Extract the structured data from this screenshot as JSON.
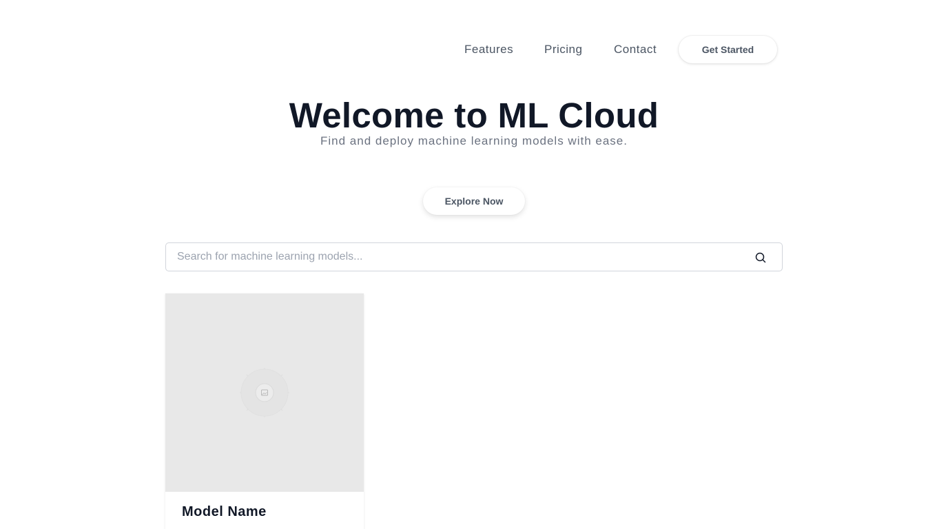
{
  "nav": {
    "links": [
      {
        "label": "Features"
      },
      {
        "label": "Pricing"
      },
      {
        "label": "Contact"
      }
    ],
    "cta_label": "Get Started"
  },
  "hero": {
    "title": "Welcome to ML Cloud",
    "subtitle": "Find and deploy machine learning models with ease.",
    "explore_label": "Explore Now"
  },
  "search": {
    "placeholder": "Search for machine learning models...",
    "value": "",
    "icon": "search-icon"
  },
  "models": [
    {
      "name": "Model Name",
      "image_icon": "image-placeholder-icon"
    }
  ]
}
